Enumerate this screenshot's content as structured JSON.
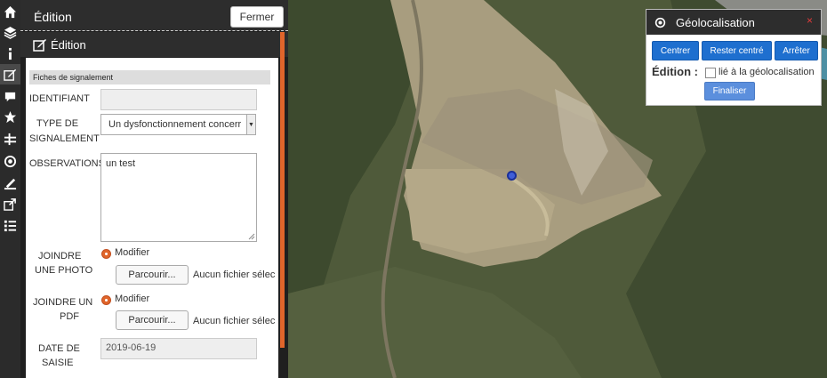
{
  "toolbar": {
    "items": [
      "home-icon",
      "layers-icon",
      "info-icon",
      "edit-icon",
      "comment-icon",
      "star-icon",
      "measure-icon",
      "geolocation-icon",
      "draw-icon",
      "share-icon",
      "list-icon"
    ]
  },
  "panel": {
    "title": "Édition",
    "close_label": "Fermer",
    "subtitle": "Édition",
    "accent_color": "#e0652b"
  },
  "form": {
    "section_title": "Fiches de signalement",
    "identifiant": {
      "label": "IDENTIFIANT",
      "value": ""
    },
    "type": {
      "label_line1": "TYPE DE",
      "label_line2": "SIGNALEMENT",
      "value": "Un dysfonctionnement concerr"
    },
    "observations": {
      "label": "OBSERVATIONS",
      "value": "un test"
    },
    "photo": {
      "label_line1": "JOINDRE",
      "label_line2": "UNE PHOTO",
      "radio_label": "Modifier",
      "browse_label": "Parcourir...",
      "no_file": "Aucun fichier sélec"
    },
    "pdf": {
      "label_line1": "JOINDRE UN",
      "label_line2": "PDF",
      "radio_label": "Modifier",
      "browse_label": "Parcourir...",
      "no_file": "Aucun fichier sélec"
    },
    "date": {
      "label_line1": "DATE DE",
      "label_line2": "SAISIE",
      "value": "2019-06-19"
    }
  },
  "geolocation": {
    "title": "Géolocalisation",
    "close_symbol": "×",
    "buttons": {
      "center": "Centrer",
      "stay_centered": "Rester centré",
      "stop": "Arrêter"
    },
    "edition_label": "Édition :",
    "checkbox_label": "lié à la géolocalisation",
    "checkbox_checked": false,
    "finish_label": "Finaliser",
    "button_color": "#1e6fcf"
  }
}
